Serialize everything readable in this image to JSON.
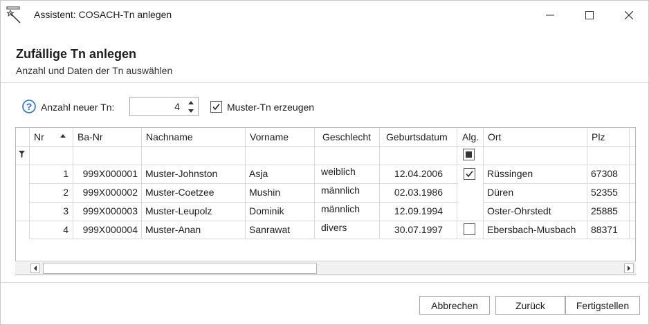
{
  "window": {
    "title": "Assistent: COSACH-Tn anlegen"
  },
  "header": {
    "title": "Zufällige Tn anlegen",
    "subtitle": "Anzahl und Daten der Tn auswählen"
  },
  "options": {
    "count_label": "Anzahl neuer Tn:",
    "count_value": "4",
    "muster_label": "Muster-Tn erzeugen",
    "muster_checked": true
  },
  "grid": {
    "columns": [
      "Nr",
      "Ba-Nr",
      "Nachname",
      "Vorname",
      "Geschlecht",
      "Geburtsdatum",
      "Alg.",
      "Ort",
      "Plz"
    ],
    "sort_column": "Nr",
    "rows": [
      {
        "nr": "1",
        "ba_nr": "999X000001",
        "nachname": "Muster-Johnston",
        "vorname": "Asja",
        "geschlecht": "weiblich",
        "geburtsdatum": "12.04.2006",
        "alg": "checked",
        "ort": "Rüssingen",
        "plz": "67308"
      },
      {
        "nr": "2",
        "ba_nr": "999X000002",
        "nachname": "Muster-Coetzee",
        "vorname": "Mushin",
        "geschlecht": "männlich",
        "geburtsdatum": "02.03.1986",
        "alg": "",
        "ort": "Düren",
        "plz": "52355"
      },
      {
        "nr": "3",
        "ba_nr": "999X000003",
        "nachname": "Muster-Leupolz",
        "vorname": "Dominik",
        "geschlecht": "männlich",
        "geburtsdatum": "12.09.1994",
        "alg": "",
        "ort": "Oster-Ohrstedt",
        "plz": "25885"
      },
      {
        "nr": "4",
        "ba_nr": "999X000004",
        "nachname": "Muster-Anan",
        "vorname": "Sanrawat",
        "geschlecht": "divers",
        "geburtsdatum": "30.07.1997",
        "alg": "unchecked",
        "ort": "Ebersbach-Musbach",
        "plz": "88371"
      }
    ]
  },
  "footer": {
    "cancel_label": "Abbrechen",
    "back_label": "Zurück",
    "finish_label": "Fertigstellen"
  },
  "colors": {
    "accent": "#1e6fd9",
    "border": "#a9a9a9"
  }
}
